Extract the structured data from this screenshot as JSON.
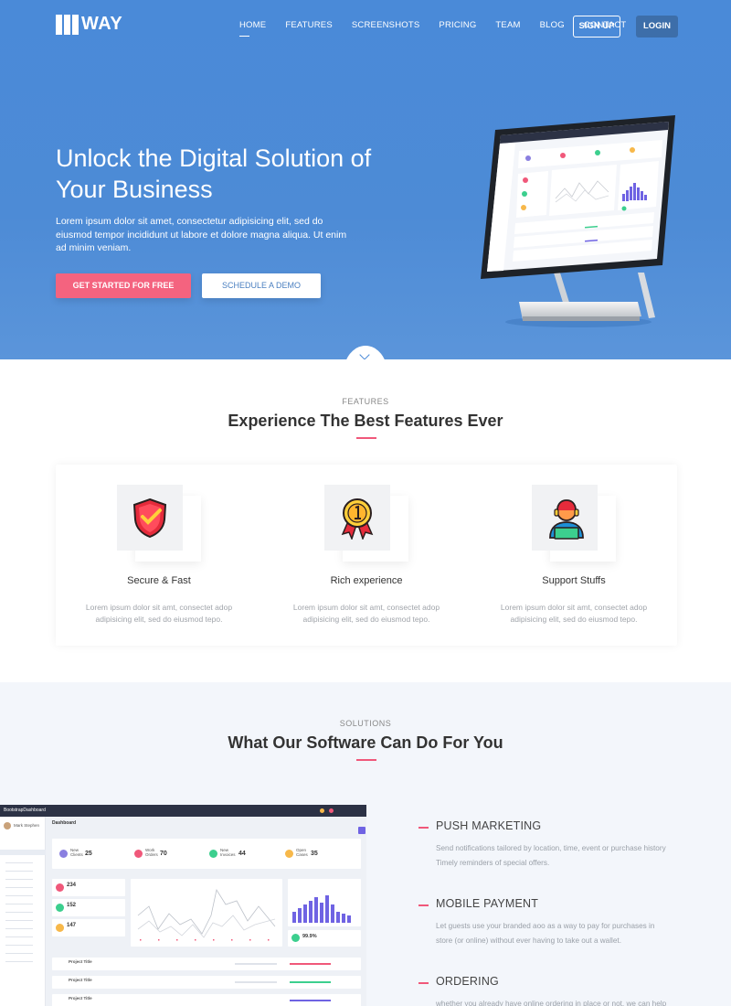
{
  "brand": {
    "name": "WAY"
  },
  "nav": {
    "items": [
      "HOME",
      "FEATURES",
      "SCREENSHOTS",
      "PRICING",
      "TEAM",
      "BLOG",
      "CONTACT"
    ],
    "signup_label": "SIGN UP",
    "login_label": "LOGIN"
  },
  "hero": {
    "title": "Unlock the Digital Solution of Your Business",
    "text": "Lorem ipsum dolor sit amet, consectetur adipisicing elit, sed do eiusmod tempor incididunt ut labore et dolore magna aliqua. Ut enim ad minim veniam.",
    "primary_cta": "GET STARTED FOR FREE",
    "secondary_cta": "SCHEDULE A DEMO"
  },
  "features": {
    "eyebrow": "FEATURES",
    "title": "Experience The Best Features Ever",
    "items": [
      {
        "icon": "shield-check-icon",
        "title": "Secure & Fast",
        "desc": "Lorem ipsum dolor sit amt, consectet adop adipisicing elit, sed do eiusmod tepo."
      },
      {
        "icon": "medal-icon",
        "title": "Rich experience",
        "desc": "Lorem ipsum dolor sit amt, consectet adop adipisicing elit, sed do eiusmod tepo."
      },
      {
        "icon": "support-agent-icon",
        "title": "Support Stuffs",
        "desc": "Lorem ipsum dolor sit amt, consectet adop adipisicing elit, sed do eiusmod tepo."
      }
    ]
  },
  "solutions": {
    "eyebrow": "SOLUTIONS",
    "title": "What Our Software Can Do For You",
    "items": [
      {
        "title": "PUSH MARKETING",
        "desc": "Send notifications tailored by location, time, event or purchase history Timely reminders of special offers."
      },
      {
        "title": "MOBILE PAYMENT",
        "desc": "Let guests use your branded aoo as a way to pay for purchases in store (or online) without ever having to take out a wallet."
      },
      {
        "title": "ORDERING",
        "desc": "whether you already have online ordering in place or not, we can help"
      }
    ]
  },
  "dashboard_preview": {
    "brand": "BootstrapDashboard",
    "page_title": "Dashboard",
    "user_name": "Mark Stephen",
    "stats": [
      {
        "label": "New Clients",
        "value": "25",
        "color": "#8a7fe0"
      },
      {
        "label": "Work Orders",
        "value": "70",
        "color": "#f0587a"
      },
      {
        "label": "New Invoices",
        "value": "44",
        "color": "#3ccf8e"
      },
      {
        "label": "Open Cases",
        "value": "35",
        "color": "#f7b84a"
      }
    ],
    "side_stats": [
      {
        "value": "234",
        "color": "#f0587a"
      },
      {
        "value": "152",
        "color": "#3ccf8e"
      },
      {
        "value": "147",
        "color": "#f7b84a"
      }
    ],
    "percent_value": "99.9%",
    "project_label": "Project Title",
    "accent": "#6f63e3"
  }
}
